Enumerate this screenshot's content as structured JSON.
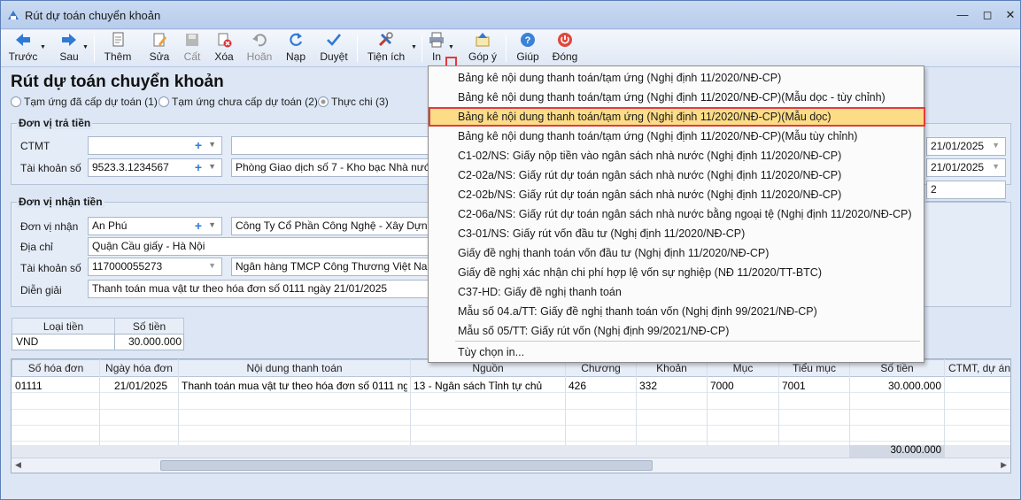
{
  "window": {
    "title": "Rút dự toán chuyển khoản"
  },
  "toolbar": {
    "back": "Trước",
    "next": "Sau",
    "add": "Thêm",
    "edit": "Sửa",
    "cut": "Cất",
    "delete": "Xóa",
    "undo": "Hoãn",
    "reload": "Nạp",
    "approve": "Duyệt",
    "utility": "Tiện ích",
    "print": "In",
    "feedback": "Góp ý",
    "help": "Giúp",
    "close": "Đóng"
  },
  "form": {
    "title": "Rút dự toán chuyển khoản",
    "radios": [
      "Tạm ứng đã cấp dự toán (1)",
      "Tạm ứng chưa cấp dự toán (2)",
      "Thực chi (3)"
    ]
  },
  "payer": {
    "group_title": "Đơn vị trả tiền",
    "ctmt_label": "CTMT",
    "ctmt_value": "",
    "ctmt_name": "",
    "account_label": "Tài khoản số",
    "account_value": "9523.3.1234567",
    "bank": "Phòng Giao dịch số 7 - Kho bạc Nhà nước K"
  },
  "payee": {
    "group_title": "Đơn vị nhận tiền",
    "unit_label": "Đơn vị nhận",
    "unit_value": "An Phú",
    "unit_name": "Công Ty Cổ Phần Công Nghệ - Xây Dựng Vă",
    "address_label": "Địa chỉ",
    "address_value": "Quận Cầu giấy - Hà Nội",
    "account_label": "Tài khoản số",
    "account_value": "117000055273",
    "bank": "Ngân hàng TMCP Công Thương Việt Nam (V",
    "desc_label": "Diễn giải",
    "desc_value": "Thanh toán mua vật tư theo hóa đơn số 0111 ngày 21/01/2025"
  },
  "right_fields": {
    "date1": "21/01/2025",
    "date2": "21/01/2025",
    "number": "2",
    "empty": ""
  },
  "currency_table": {
    "col1": "Loại tiền",
    "col2": "Số tiền",
    "currency": "VND",
    "amount": "30.000.000"
  },
  "grid": {
    "headers": [
      "Số hóa đơn",
      "Ngày hóa đơn",
      "Nội dung thanh toán",
      "Nguồn",
      "Chương",
      "Khoản",
      "Mục",
      "Tiểu mục",
      "Số tiền",
      "CTMT, dự án"
    ],
    "row": [
      "01111",
      "21/01/2025",
      "Thanh toán mua vật tư theo hóa đơn số 0111 ngà...",
      "13 - Ngân sách Tỉnh tự chủ",
      "426",
      "332",
      "7000",
      "7001",
      "30.000.000",
      ""
    ],
    "total": "30.000.000"
  },
  "print_menu": {
    "items": [
      "Bảng kê nội dung thanh toán/tạm ứng (Nghị định 11/2020/NĐ-CP)",
      "Bảng kê nội dung thanh toán/tạm ứng (Nghị định 11/2020/NĐ-CP)(Mẫu dọc - tùy chỉnh)",
      "Bảng kê nội dung thanh toán/tạm ứng (Nghị định 11/2020/NĐ-CP)(Mẫu dọc)",
      "Bảng kê nội dung thanh toán/tạm ứng (Nghị định 11/2020/NĐ-CP)(Mẫu tùy chỉnh)",
      "C1-02/NS: Giấy nộp tiền vào ngân sách nhà nước (Nghị định 11/2020/NĐ-CP)",
      "C2-02a/NS: Giấy rút dự toán ngân sách nhà nước (Nghị định 11/2020/NĐ-CP)",
      "C2-02b/NS: Giấy rút dự toán ngân sách nhà nước (Nghị định 11/2020/NĐ-CP)",
      "C2-06a/NS: Giấy rút dự toán ngân sách nhà nước bằng ngoại tệ (Nghị định 11/2020/NĐ-CP)",
      "C3-01/NS: Giấy rút vốn đầu tư (Nghị định 11/2020/NĐ-CP)",
      "Giấy đề nghị thanh toán vốn đầu tư (Nghị định 11/2020/NĐ-CP)",
      "Giấy đề nghị xác nhận chi phí hợp lệ vốn sự nghiệp (NĐ 11/2020/TT-BTC)",
      "C37-HD: Giấy đề nghị thanh toán",
      "Mẫu số 04.a/TT: Giấy đề nghị thanh toán vốn (Nghị định 99/2021/NĐ-CP)",
      "Mẫu số 05/TT: Giấy rút vốn (Nghị định 99/2021/NĐ-CP)"
    ],
    "options": "Tùy chọn in..."
  }
}
